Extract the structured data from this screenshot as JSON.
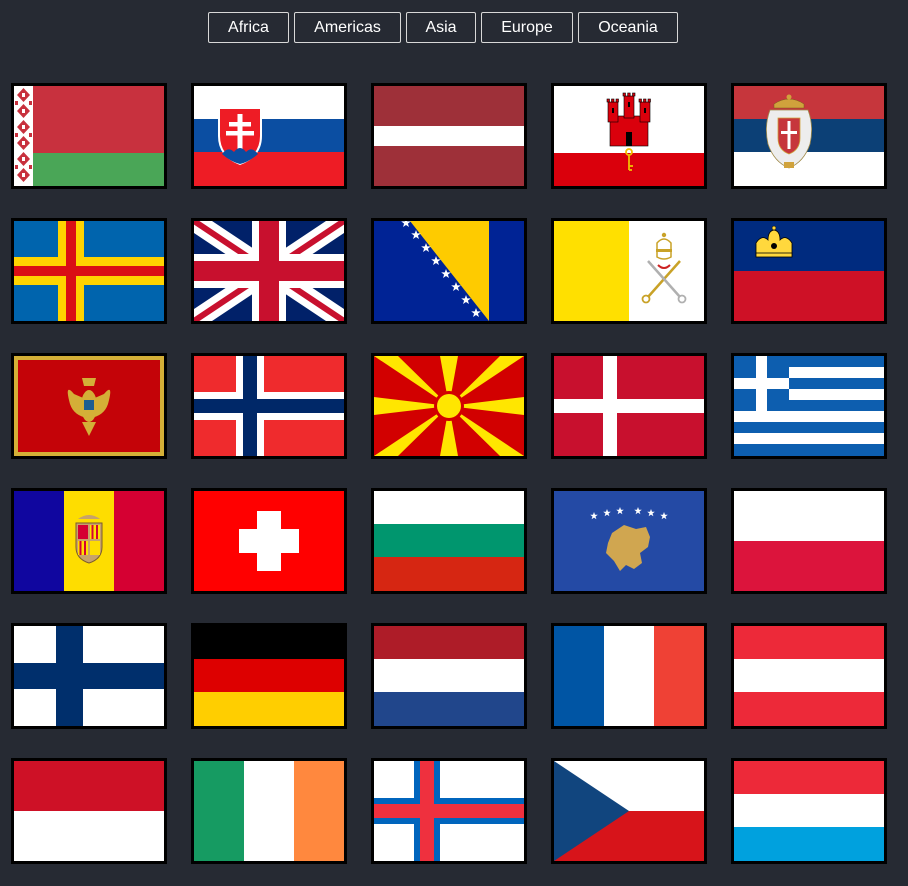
{
  "nav": {
    "regions": [
      "Africa",
      "Americas",
      "Asia",
      "Europe",
      "Oceania"
    ]
  },
  "flags": [
    "belarus",
    "slovakia",
    "latvia",
    "gibraltar",
    "serbia",
    "aland-islands",
    "united-kingdom",
    "bosnia-and-herzegovina",
    "vatican-city",
    "liechtenstein",
    "montenegro",
    "norway",
    "north-macedonia",
    "denmark",
    "greece",
    "andorra",
    "switzerland",
    "bulgaria",
    "kosovo",
    "poland",
    "finland",
    "germany",
    "netherlands",
    "france",
    "austria",
    "monaco",
    "ireland",
    "faroe-islands",
    "czech-republic",
    "luxembourg"
  ],
  "colors": {
    "background": "#262a33",
    "button_border": "#d8d8d8",
    "flag_border": "#000000"
  }
}
